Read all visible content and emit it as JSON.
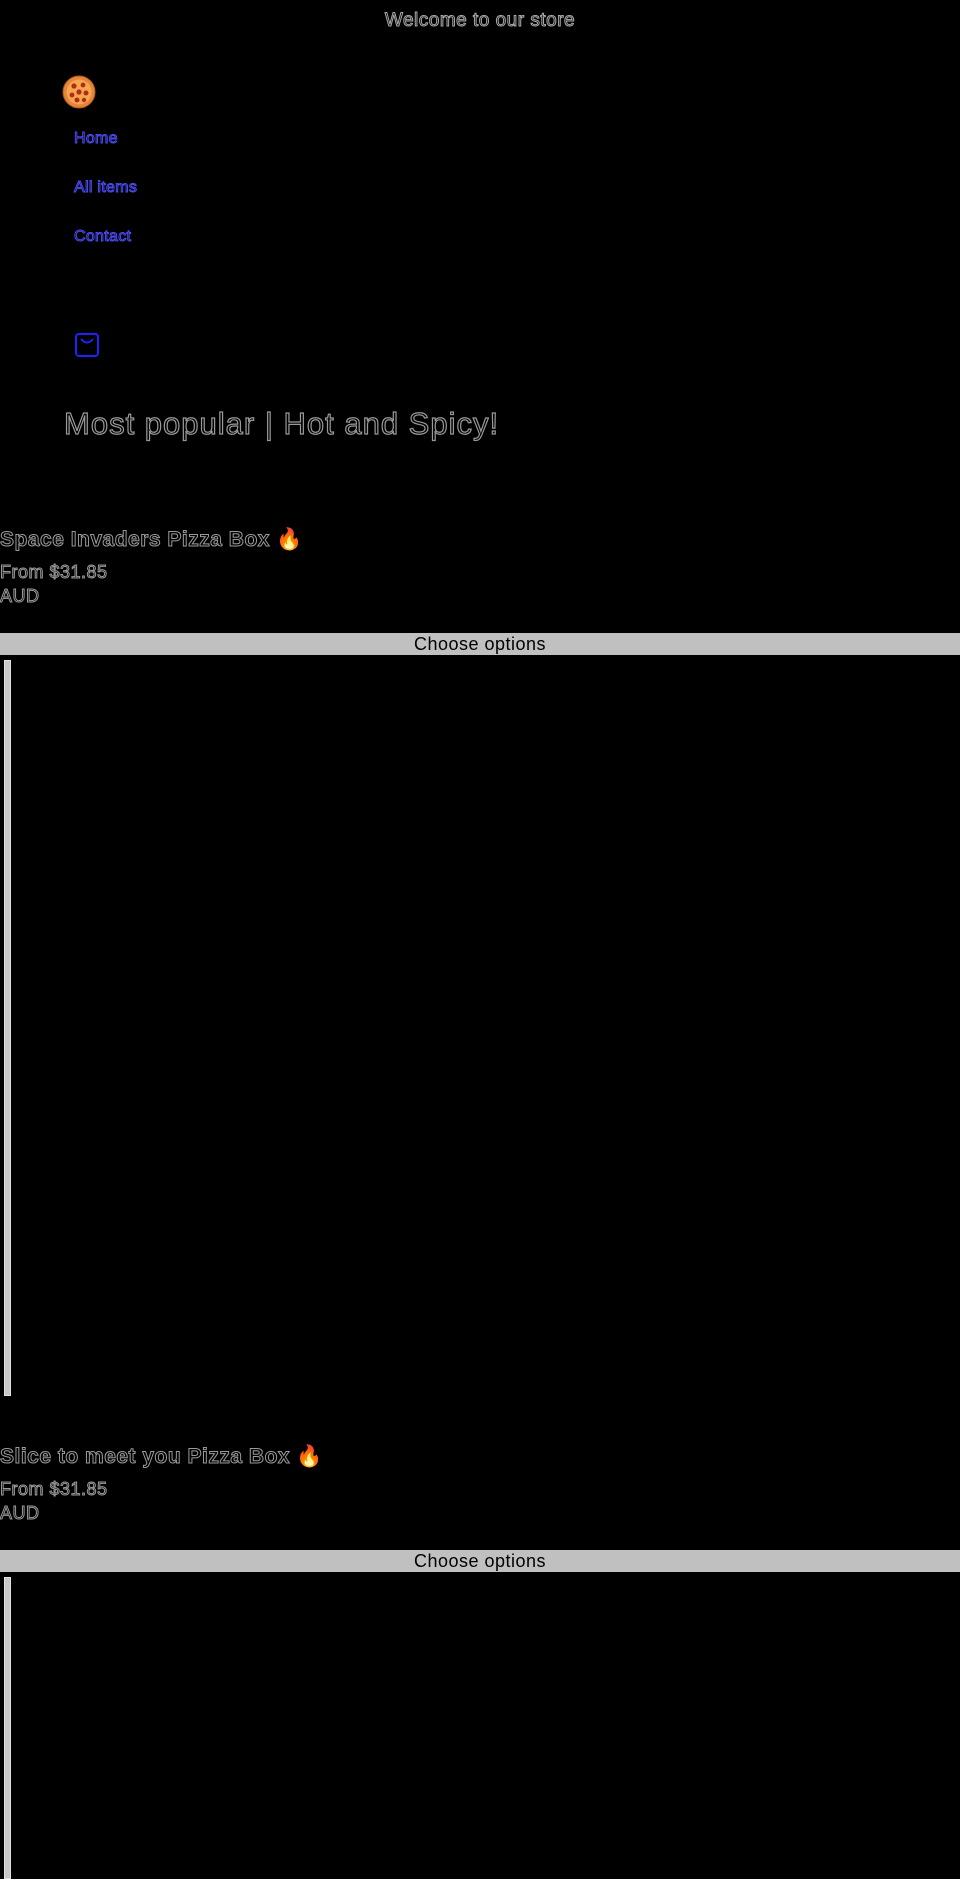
{
  "announcement": "Welcome to our store",
  "header": {
    "logo_icon": "pizza-icon",
    "cart_icon": "shopping-bag-icon",
    "nav": [
      {
        "label": "Home"
      },
      {
        "label": "All items"
      },
      {
        "label": "Contact"
      }
    ]
  },
  "collection": {
    "title": "Most popular | Hot and Spicy!"
  },
  "products": [
    {
      "title": "Space Invaders Pizza Box 🔥",
      "price": "From $31.85 AUD",
      "button_label": "Choose options"
    },
    {
      "title": "Slice to meet you Pizza Box 🔥",
      "price": "From $31.85 AUD",
      "button_label": "Choose options"
    }
  ],
  "colors": {
    "background": "#000000",
    "link": "#4a4af0",
    "button_bg": "#c0c0c0",
    "pizza_crust": "#e8843a",
    "pizza_cheese": "#f2a84e",
    "pepperoni": "#b52a1c"
  }
}
